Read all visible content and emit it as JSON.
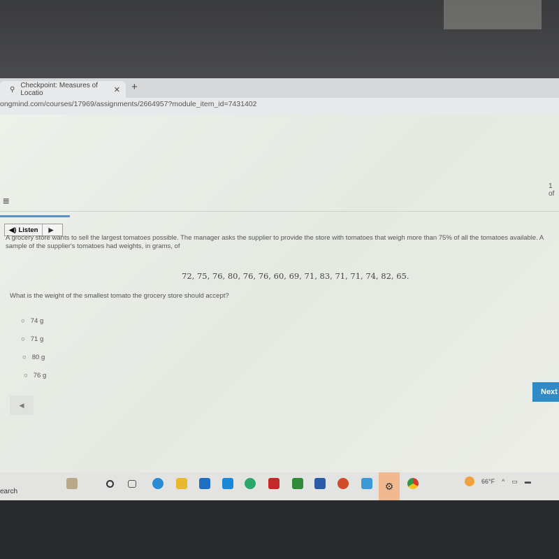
{
  "browser": {
    "tab_title": "Checkpoint: Measures of Locatio",
    "tab_close": "✕",
    "new_tab": "+",
    "url": "ongmind.com/courses/17969/assignments/2664957?module_item_id=7431402"
  },
  "header": {
    "menu_icon": "≡",
    "pager": "1 of"
  },
  "listen": {
    "label": "Listen",
    "play": "▶"
  },
  "question": {
    "text": "A grocery store wants to sell the largest tomatoes possible. The manager asks the supplier to provide the store with tomatoes that weigh more than 75% of all the tomatoes available. A",
    "text2": "sample of the supplier's tomatoes had weights, in grams, of",
    "data": "72, 75, 76, 80, 76, 76, 60, 69, 71, 83, 71, 71, 74, 82, 65.",
    "prompt": "What is the weight of the smallest tomato the grocery store should accept?"
  },
  "options": [
    {
      "label": "74 g"
    },
    {
      "label": "71 g"
    },
    {
      "label": "80 g"
    },
    {
      "label": "76 g"
    }
  ],
  "nav": {
    "next": "Next",
    "back": "◀"
  },
  "taskbar": {
    "search": "earch",
    "weather": "66°F",
    "tray": "^"
  }
}
